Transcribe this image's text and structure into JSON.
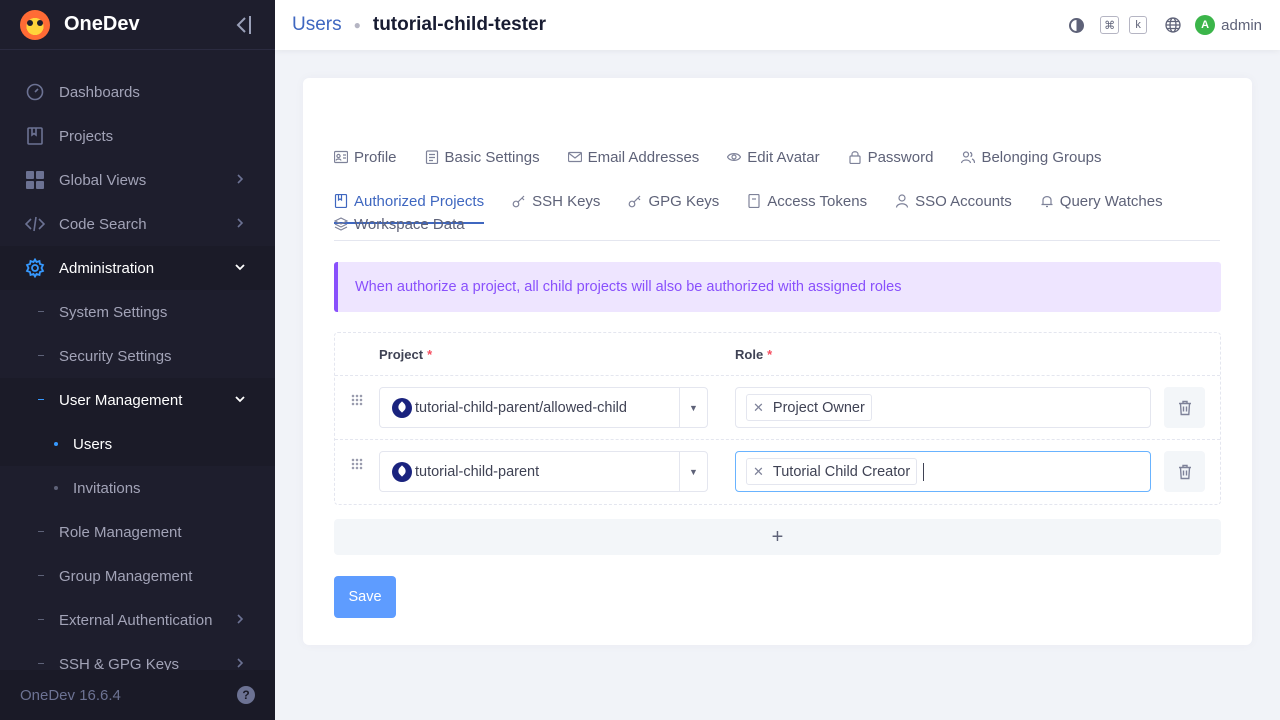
{
  "app": {
    "name": "OneDev",
    "version_label": "OneDev 16.6.4"
  },
  "sidebar": {
    "items": [
      {
        "label": "Dashboards"
      },
      {
        "label": "Projects"
      },
      {
        "label": "Global Views"
      },
      {
        "label": "Code Search"
      },
      {
        "label": "Administration"
      },
      {
        "label": "System Settings"
      },
      {
        "label": "Security Settings"
      },
      {
        "label": "User Management"
      },
      {
        "label": "Users"
      },
      {
        "label": "Invitations"
      },
      {
        "label": "Role Management"
      },
      {
        "label": "Group Management"
      },
      {
        "label": "External Authentication"
      },
      {
        "label": "SSH & GPG Keys"
      }
    ]
  },
  "header": {
    "breadcrumb_parent": "Users",
    "breadcrumb_current": "tutorial-child-tester",
    "kbd_cmd": "⌘",
    "kbd_k": "k",
    "user_initial": "A",
    "user_name": "admin"
  },
  "tabs": [
    {
      "label": "Profile"
    },
    {
      "label": "Basic Settings"
    },
    {
      "label": "Email Addresses"
    },
    {
      "label": "Edit Avatar"
    },
    {
      "label": "Password"
    },
    {
      "label": "Belonging Groups"
    },
    {
      "label": "Authorized Projects"
    },
    {
      "label": "SSH Keys"
    },
    {
      "label": "GPG Keys"
    },
    {
      "label": "Access Tokens"
    },
    {
      "label": "SSO Accounts"
    },
    {
      "label": "Query Watches"
    },
    {
      "label": "Workspace Data"
    }
  ],
  "alert": {
    "text": "When authorize a project, all child projects will also be authorized with assigned roles"
  },
  "table": {
    "col_project": "Project",
    "col_role": "Role",
    "required_mark": "*",
    "rows": [
      {
        "project": "tutorial-child-parent/allowed-child",
        "role": "Project Owner"
      },
      {
        "project": "tutorial-child-parent",
        "role": "Tutorial Child Creator"
      }
    ],
    "add_label": "+"
  },
  "actions": {
    "save_label": "Save"
  },
  "colors": {
    "accent": "#3f67c0",
    "alert_purple": "#8950fc",
    "sidebar_bg": "#1e1e2d",
    "save_bg": "#5e9cff"
  }
}
